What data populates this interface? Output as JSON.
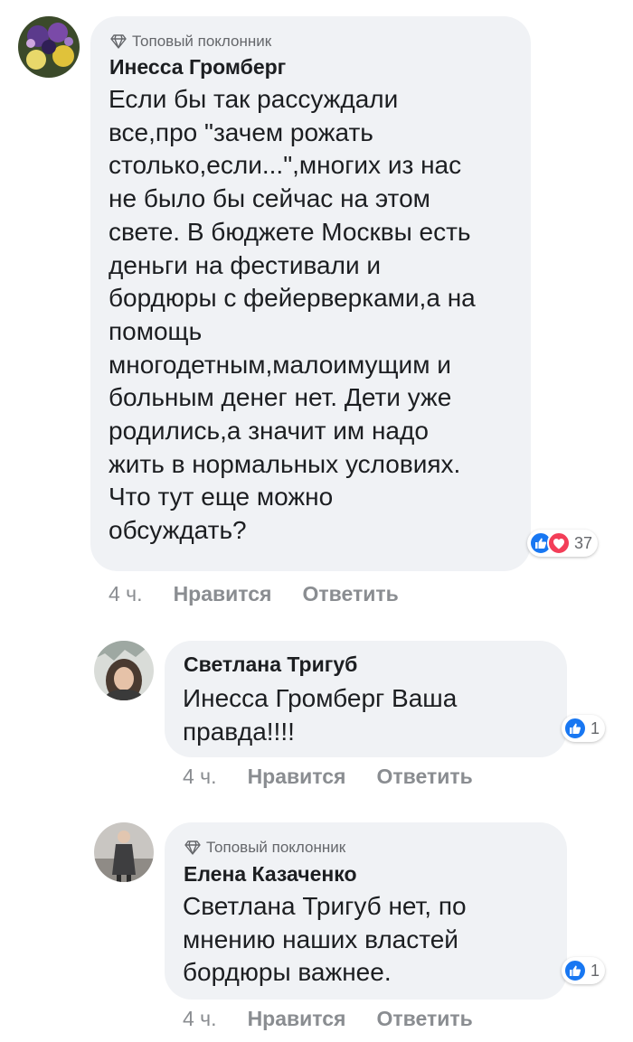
{
  "comments": [
    {
      "badge": "Топовый поклонник",
      "author": "Инесса Громберг",
      "text": "Если бы так рассуждали\nвсе,про \"зачем рожать\nстолько,если...\",многих из нас\nне было бы сейчас на этом\nсвете. В бюджете Москвы есть\nденьги на фестивали и\nбордюры с фейерверками,а на\nпомощь\nмногодетным,малоимущим и\nбольным денег нет. Дети уже\nродились,а значит им надо\nжить в нормальных условиях.\nЧто тут еще можно\nобсуждать?",
      "reactions": [
        "like-icon",
        "love-icon"
      ],
      "reaction_count": "37",
      "time": "4 ч.",
      "like_label": "Нравится",
      "reply_label": "Ответить"
    },
    {
      "author": "Светлана Тригуб",
      "text": "Инесса Громберг Ваша\nправда!!!!",
      "reactions": [
        "like-icon"
      ],
      "reaction_count": "1",
      "time": "4 ч.",
      "like_label": "Нравится",
      "reply_label": "Ответить"
    },
    {
      "badge": "Топовый поклонник",
      "author": "Елена Казаченко",
      "text": "Светлана Тригуб нет, по\nмнению наших властей\nбордюры важнее.",
      "reactions": [
        "like-icon"
      ],
      "reaction_count": "1",
      "time": "4 ч.",
      "like_label": "Нравится",
      "reply_label": "Ответить"
    }
  ],
  "colors": {
    "bubble": "#f0f2f5",
    "meta_text": "#8a8d91",
    "like_blue": "#1877f2",
    "love_red": "#f33e58"
  }
}
